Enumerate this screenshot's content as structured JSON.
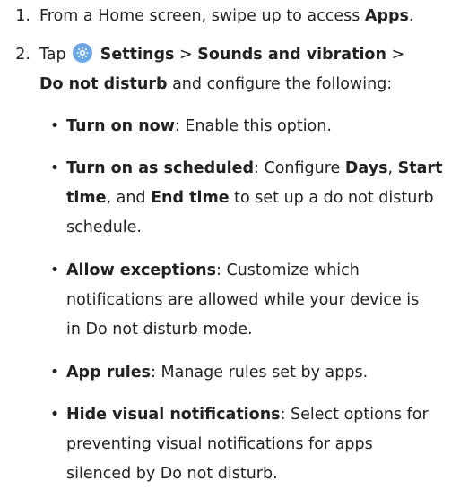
{
  "steps": [
    {
      "number": "1.",
      "pre": "From a Home screen, swipe up to access ",
      "bold": "Apps",
      "post": "."
    },
    {
      "number": "2.",
      "tap": "Tap",
      "settings": "Settings",
      "sep1": ">",
      "sounds": "Sounds and vibration",
      "sep2": ">",
      "dnd": "Do not disturb",
      "rest": " and configure the following:"
    }
  ],
  "options": [
    {
      "term": "Turn on now",
      "desc": ": Enable this option."
    },
    {
      "term": "Turn on as scheduled",
      "desc_1": ": Configure ",
      "days": "Days",
      "comma": ", ",
      "start": "Start",
      "start2": "time",
      "desc_2": ", and ",
      "end": "End time",
      "desc_3": " to set up a do not disturb",
      "desc_4": "schedule."
    },
    {
      "term": "Allow exceptions",
      "desc_1": ": Customize which",
      "desc_2": "notifications are allowed while your device is",
      "desc_3": "in Do not disturb mode."
    },
    {
      "term": "App rules",
      "desc": ": Manage rules set by apps."
    },
    {
      "term": "Hide visual notifications",
      "desc_1": ": Select options for",
      "desc_2": "preventing visual notifications for apps",
      "desc_3": "silenced by Do not disturb."
    }
  ],
  "icon": "settings-gear-icon",
  "bullet_glyph": "•",
  "colors": {
    "text": "#222222",
    "settings_icon": "#6ba6e6"
  }
}
